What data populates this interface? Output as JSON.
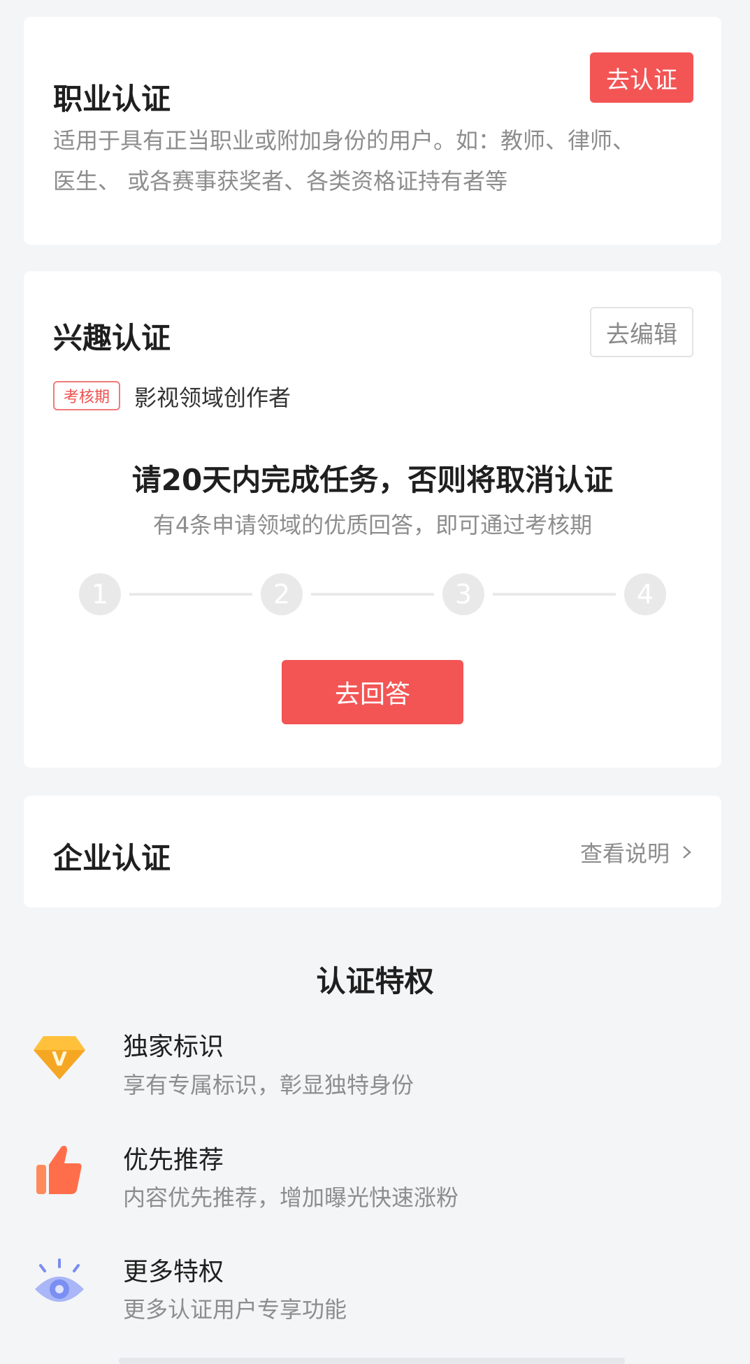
{
  "professional": {
    "title": "职业认证",
    "button": "去认证",
    "description_line1": "适用于具有正当职业或附加身份的用户。如：教师、律师、",
    "description_line2": "医生、 或各赛事获奖者、各类资格证持有者等"
  },
  "interest": {
    "title": "兴趣认证",
    "button": "去编辑",
    "tag": "考核期",
    "domain": "影视领域创作者",
    "task_heading": "请20天内完成任务，否则将取消认证",
    "task_sub": "有4条申请领域的优质回答，即可通过考核期",
    "steps": [
      "1",
      "2",
      "3",
      "4"
    ],
    "action_button": "去回答"
  },
  "enterprise": {
    "title": "企业认证",
    "link": "查看说明"
  },
  "privileges": {
    "heading": "认证特权",
    "items": [
      {
        "icon": "diamond-v-icon",
        "title": "独家标识",
        "sub": "享有专属标识，彰显独特身份"
      },
      {
        "icon": "thumbs-up-icon",
        "title": "优先推荐",
        "sub": "内容优先推荐，增加曝光快速涨粉"
      },
      {
        "icon": "eye-icon",
        "title": "更多特权",
        "sub": "更多认证用户专享功能"
      }
    ]
  },
  "colors": {
    "accent_red": "#f35555",
    "background": "#f4f5f7"
  }
}
